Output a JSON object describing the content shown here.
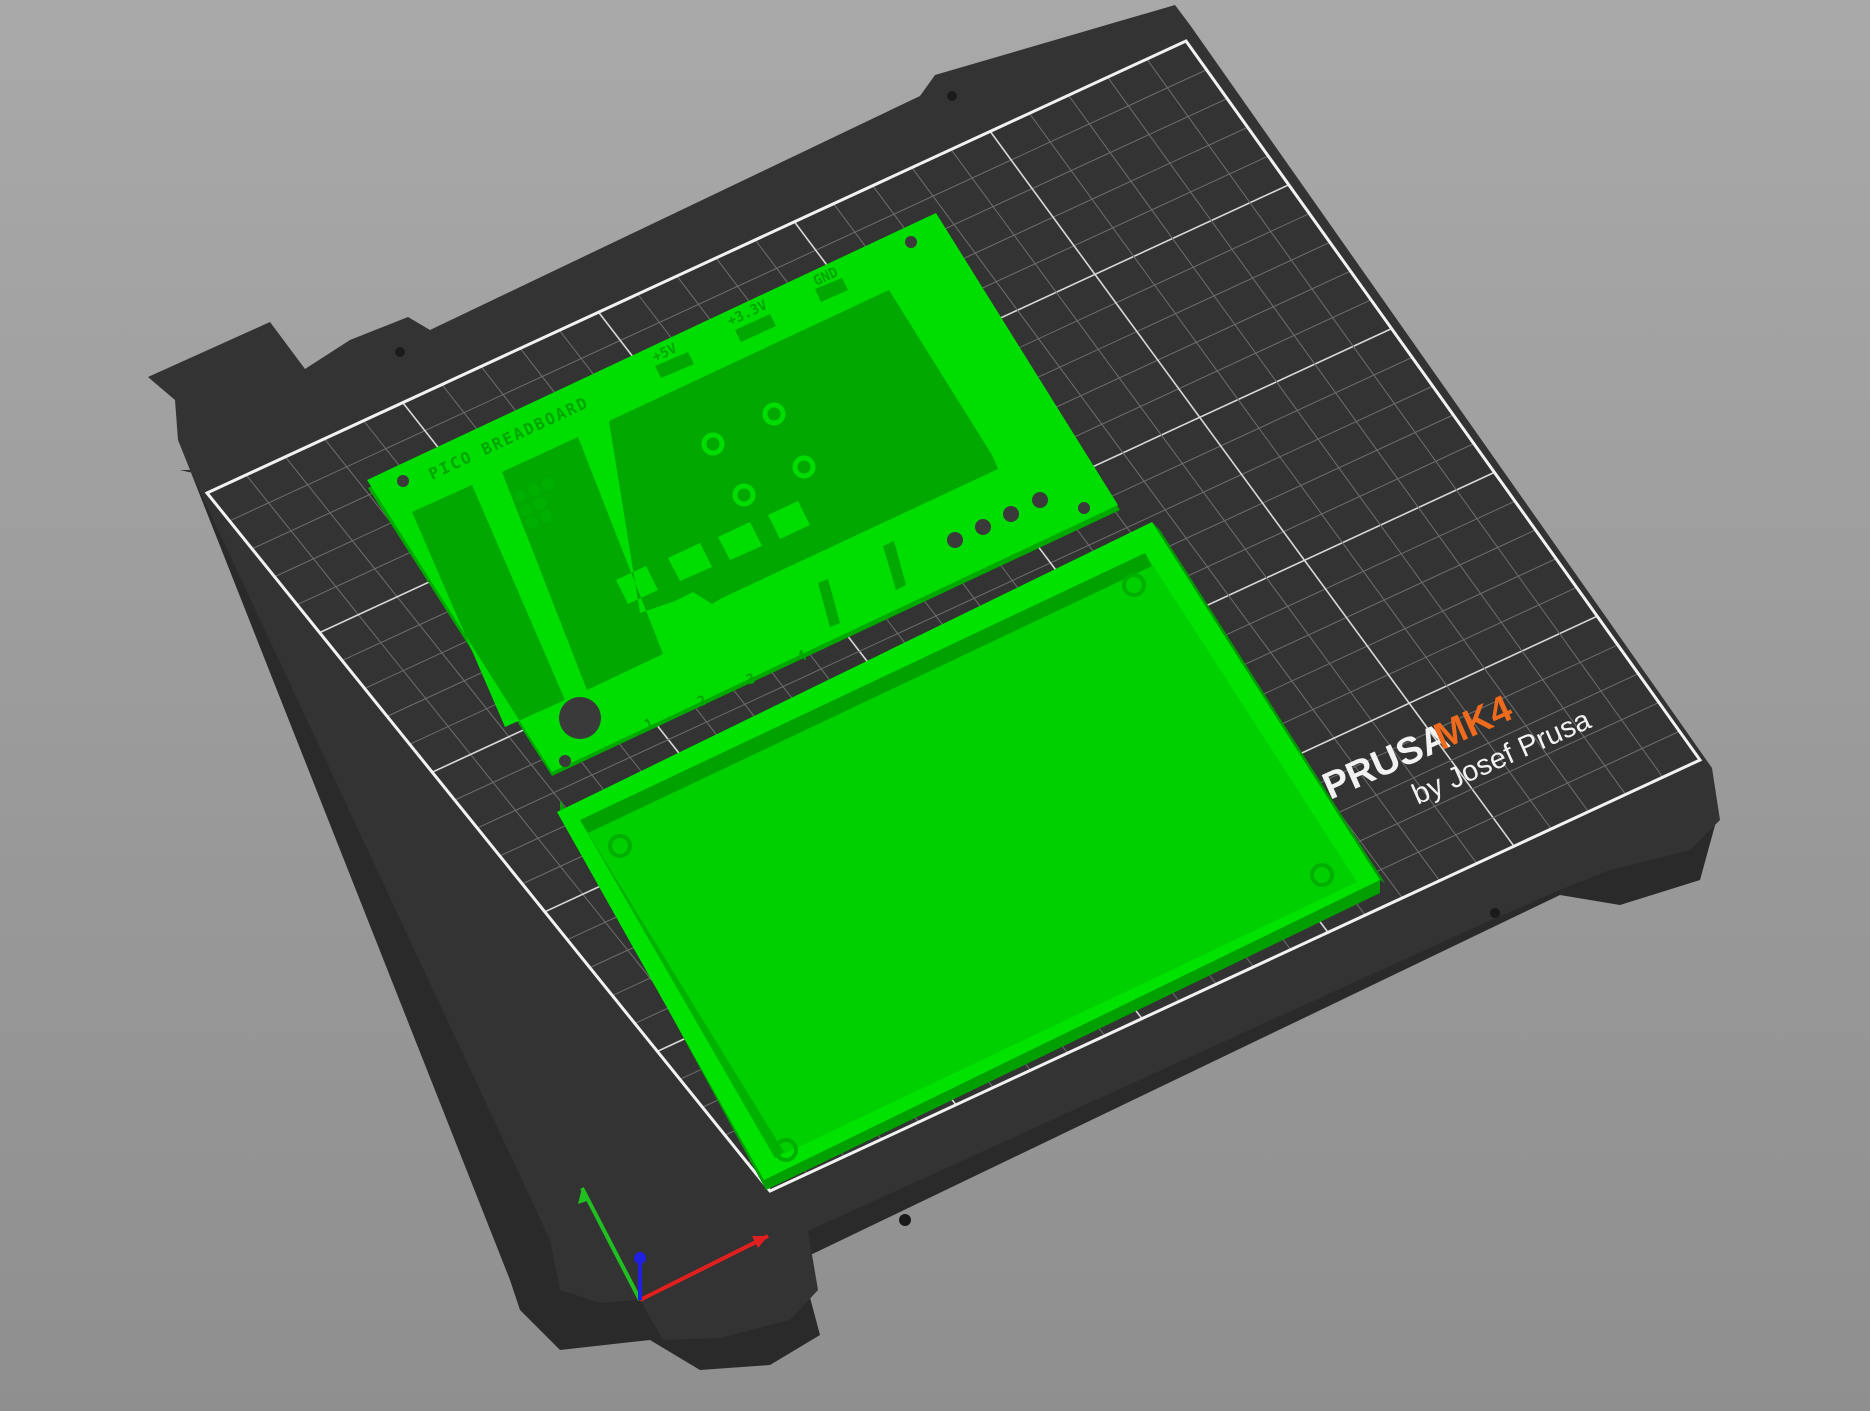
{
  "bed": {
    "brand_prefix": "PRUSA",
    "brand_model": "MK4",
    "brand_sub": "by Josef Prusa",
    "colors": {
      "sheet": "#333333",
      "sheet_edge": "#262626",
      "grid": "#6e6e6e",
      "grid_major": "#d8d8d8",
      "border": "#f2f2f2",
      "model": "#00dd00",
      "model_dark": "#00b000",
      "model_shadow": "#009a00",
      "brand_accent": "#ee6a1c"
    }
  },
  "panel": {
    "title_engraving": "PICO BREADBOARD",
    "rail_labels": [
      "+5V",
      "+3.3V",
      "GND"
    ],
    "slot_numbers": [
      "1",
      "2",
      "3",
      "4"
    ],
    "logo_icon": "raspberry-pi-logo"
  },
  "axes": {
    "x_color": "#e02020",
    "y_color": "#20c020",
    "z_color": "#2020e0"
  }
}
